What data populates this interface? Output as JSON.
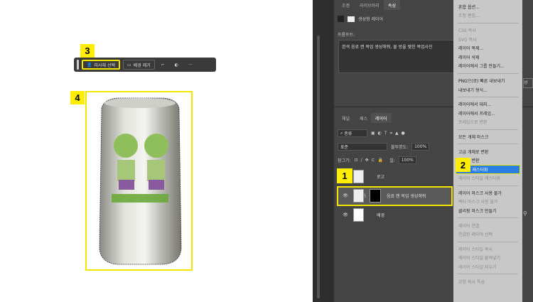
{
  "canvas": {
    "toolbar": {
      "select_subject": "피사체 선택",
      "remove_background": "배경 제거",
      "more": "···"
    },
    "badges": [
      "1",
      "2",
      "3",
      "4"
    ]
  },
  "properties": {
    "tabs": [
      "조정",
      "라이브러리",
      "속성"
    ],
    "layer_type": "생성형 레이어",
    "prompt_label": "프롬프트:",
    "prompt_text": "흰색 음료 캔 목업 생성해줘, 물 방울 맺힌 목업사진",
    "generate_partial": "성"
  },
  "layers": {
    "tabs": [
      "채널",
      "패스",
      "레이어"
    ],
    "filter": "종류",
    "blend_mode": "표준",
    "opacity_label": "불투명도:",
    "opacity": "100%",
    "lock_label": "잠그기:",
    "fill_label": "칠:",
    "fill": "100%",
    "items": [
      {
        "name": "로고"
      },
      {
        "name": "음료 캔 목업 생성해줘"
      },
      {
        "name": "배경"
      }
    ]
  },
  "context_menu": [
    {
      "label": "혼합 옵션...",
      "enabled": true
    },
    {
      "label": "조정 편집...",
      "enabled": false
    },
    {
      "sep": true
    },
    {
      "label": "CSS 복사",
      "enabled": false
    },
    {
      "label": "SVG 복사",
      "enabled": false
    },
    {
      "label": "레이어 복제...",
      "enabled": true
    },
    {
      "label": "레이어 삭제",
      "enabled": true
    },
    {
      "label": "레이어에서 그룹 만들기...",
      "enabled": true
    },
    {
      "sep": true
    },
    {
      "label": "PNG으(로) 빠른 내보내기",
      "enabled": true
    },
    {
      "label": "내보내기 형식...",
      "enabled": true
    },
    {
      "sep": true
    },
    {
      "label": "레이어에서 대지...",
      "enabled": true
    },
    {
      "label": "레이어에서 프레임...",
      "enabled": true
    },
    {
      "label": "프레임으로 변환",
      "enabled": false
    },
    {
      "sep": true
    },
    {
      "label": "모든 개체 마스크",
      "enabled": true
    },
    {
      "sep": true
    },
    {
      "label": "고급 개체로 변환",
      "enabled": true
    },
    {
      "label": "개체로 변환",
      "enabled": true
    },
    {
      "label": "레이어 래스터화",
      "enabled": true,
      "highlight": true
    },
    {
      "label": "레이어 스타일 래스터화",
      "enabled": false
    },
    {
      "sep": true
    },
    {
      "label": "레이어 마스크 사용 불가",
      "enabled": true
    },
    {
      "label": "벡터 마스크 사용 불가",
      "enabled": false
    },
    {
      "label": "클리핑 마스크 만들기",
      "enabled": true
    },
    {
      "sep": true
    },
    {
      "label": "레이어 연결",
      "enabled": false
    },
    {
      "label": "연결된 레이어 선택",
      "enabled": false
    },
    {
      "sep": true
    },
    {
      "label": "레이어 스타일 복사",
      "enabled": false
    },
    {
      "label": "레이어 스타일 붙여넣기",
      "enabled": false
    },
    {
      "label": "레이어 스타일 지우기",
      "enabled": false
    },
    {
      "sep": true
    },
    {
      "label": "모양 복사 특성",
      "enabled": false
    }
  ],
  "colors": {
    "highlight": "#2a7de1",
    "annotation": "#f2e600"
  }
}
